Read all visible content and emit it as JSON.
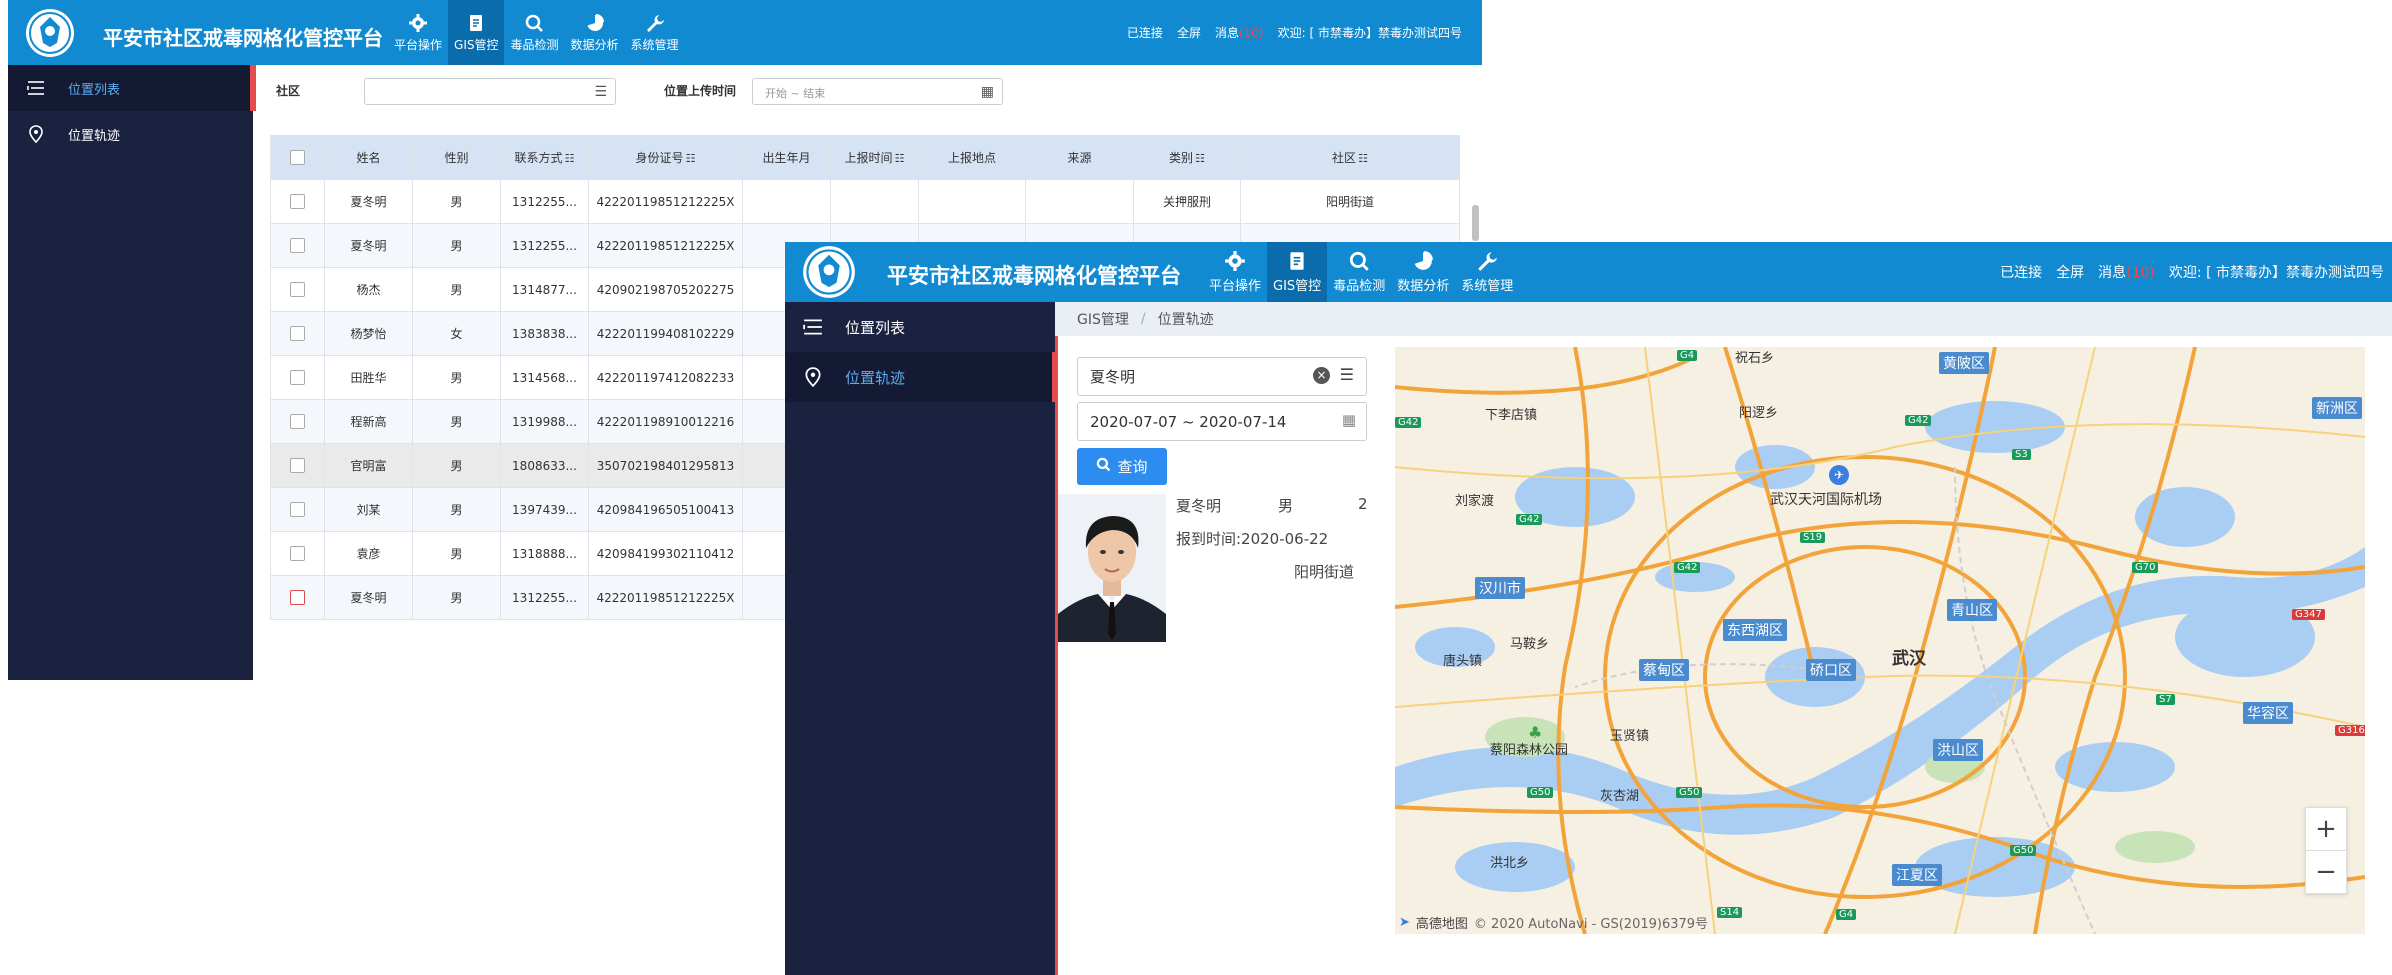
{
  "app": {
    "title": "平安市社区戒毒网格化管控平台",
    "nav": [
      {
        "label": "平台操作",
        "icon": "gear-icon"
      },
      {
        "label": "GIS管控",
        "icon": "document-icon"
      },
      {
        "label": "毒品检测",
        "icon": "search-icon"
      },
      {
        "label": "数据分析",
        "icon": "pie-chart-icon"
      },
      {
        "label": "系统管理",
        "icon": "wrench-icon"
      }
    ],
    "active_nav": "GIS管控",
    "status": {
      "connected": "已连接",
      "fullscreen": "全屏",
      "messages": "消息",
      "message_count": "(10)",
      "welcome": "欢迎: [",
      "user": "市禁毒办】禁毒办测试四号"
    }
  },
  "sidebar": {
    "items": [
      {
        "label": "位置列表",
        "icon": "list-icon"
      },
      {
        "label": "位置轨迹",
        "icon": "location-pin-icon"
      }
    ]
  },
  "list_view": {
    "filters": {
      "community_label": "社区",
      "community_value": "",
      "upload_time_label": "位置上传时间",
      "upload_time_placeholder": "开始 ~ 结束"
    },
    "columns": [
      "姓名",
      "性别",
      "联系方式",
      "身份证号",
      "出生年月",
      "上报时间",
      "上报地点",
      "来源",
      "类别",
      "社区"
    ],
    "rows": [
      {
        "name": "夏冬明",
        "gender": "男",
        "phone": "1312255...",
        "id": "42220119851212225X",
        "birth": "",
        "report_time": "",
        "report_place": "",
        "source": "",
        "category": "关押服刑",
        "community": "阳明街道"
      },
      {
        "name": "夏冬明",
        "gender": "男",
        "phone": "1312255...",
        "id": "42220119851212225X",
        "birth": "",
        "report_time": "",
        "report_place": "",
        "source": "",
        "category": "",
        "community": ""
      },
      {
        "name": "杨杰",
        "gender": "男",
        "phone": "1314877...",
        "id": "420902198705202275",
        "birth": "",
        "report_time": "",
        "report_place": "",
        "source": "",
        "category": "",
        "community": ""
      },
      {
        "name": "杨梦怡",
        "gender": "女",
        "phone": "1383838...",
        "id": "422201199408102229",
        "birth": "",
        "report_time": "",
        "report_place": "",
        "source": "",
        "category": "",
        "community": ""
      },
      {
        "name": "田胜华",
        "gender": "男",
        "phone": "1314568...",
        "id": "422201197412082233",
        "birth": "",
        "report_time": "",
        "report_place": "",
        "source": "",
        "category": "",
        "community": ""
      },
      {
        "name": "程新高",
        "gender": "男",
        "phone": "1319988...",
        "id": "422201198910012216",
        "birth": "",
        "report_time": "",
        "report_place": "",
        "source": "",
        "category": "",
        "community": ""
      },
      {
        "name": "官明富",
        "gender": "男",
        "phone": "1808633...",
        "id": "350702198401295813",
        "birth": "",
        "report_time": "",
        "report_place": "",
        "source": "",
        "category": "",
        "community": ""
      },
      {
        "name": "刘某",
        "gender": "男",
        "phone": "1397439...",
        "id": "420984196505100413",
        "birth": "",
        "report_time": "",
        "report_place": "",
        "source": "",
        "category": "",
        "community": ""
      },
      {
        "name": "袁彦",
        "gender": "男",
        "phone": "1318888...",
        "id": "420984199302110412",
        "birth": "",
        "report_time": "",
        "report_place": "",
        "source": "",
        "category": "",
        "community": ""
      },
      {
        "name": "夏冬明",
        "gender": "男",
        "phone": "1312255...",
        "id": "42220119851212225X",
        "birth": "",
        "report_time": "",
        "report_place": "",
        "source": "",
        "category": "",
        "community": ""
      }
    ]
  },
  "track_view": {
    "breadcrumb": [
      "GIS管理",
      "位置轨迹"
    ],
    "person_search_value": "夏冬明",
    "date_range_value": "2020-07-07 ~ 2020-07-14",
    "query_button": "查询",
    "person": {
      "name": "夏冬明",
      "gender": "男",
      "count": "2",
      "report_time": "报到时间:2020-06-22",
      "community": "阳明街道"
    },
    "map": {
      "city_label": "武汉",
      "labels": [
        "下李店镇",
        "阳逻乡",
        "祝石乡",
        "刘家渡",
        "武汉天河国际机场",
        "马鞍乡",
        "唐头镇",
        "玉贤镇",
        "蔡阳森林公园",
        "洪北乡",
        "灰杏湖"
      ],
      "districts": [
        "黄陂区",
        "新洲区",
        "汉川市",
        "东西湖区",
        "蔡甸区",
        "硚口区",
        "青山区",
        "洪山区",
        "华容区",
        "江夏区"
      ],
      "roads": [
        "G4",
        "G42",
        "S3",
        "S19",
        "G70",
        "G347",
        "G50",
        "S7",
        "G316",
        "S14"
      ],
      "attribution_brand": "高德地图",
      "attribution": "© 2020 AutoNavi - GS(2019)6379号",
      "zoom_in": "+",
      "zoom_out": "−"
    }
  },
  "colors": {
    "topbar": "#118ad1",
    "sidebar": "#1b2240",
    "active_accent": "#e54d4d",
    "active_text": "#5aaef0",
    "primary_button": "#2d8cf0"
  }
}
